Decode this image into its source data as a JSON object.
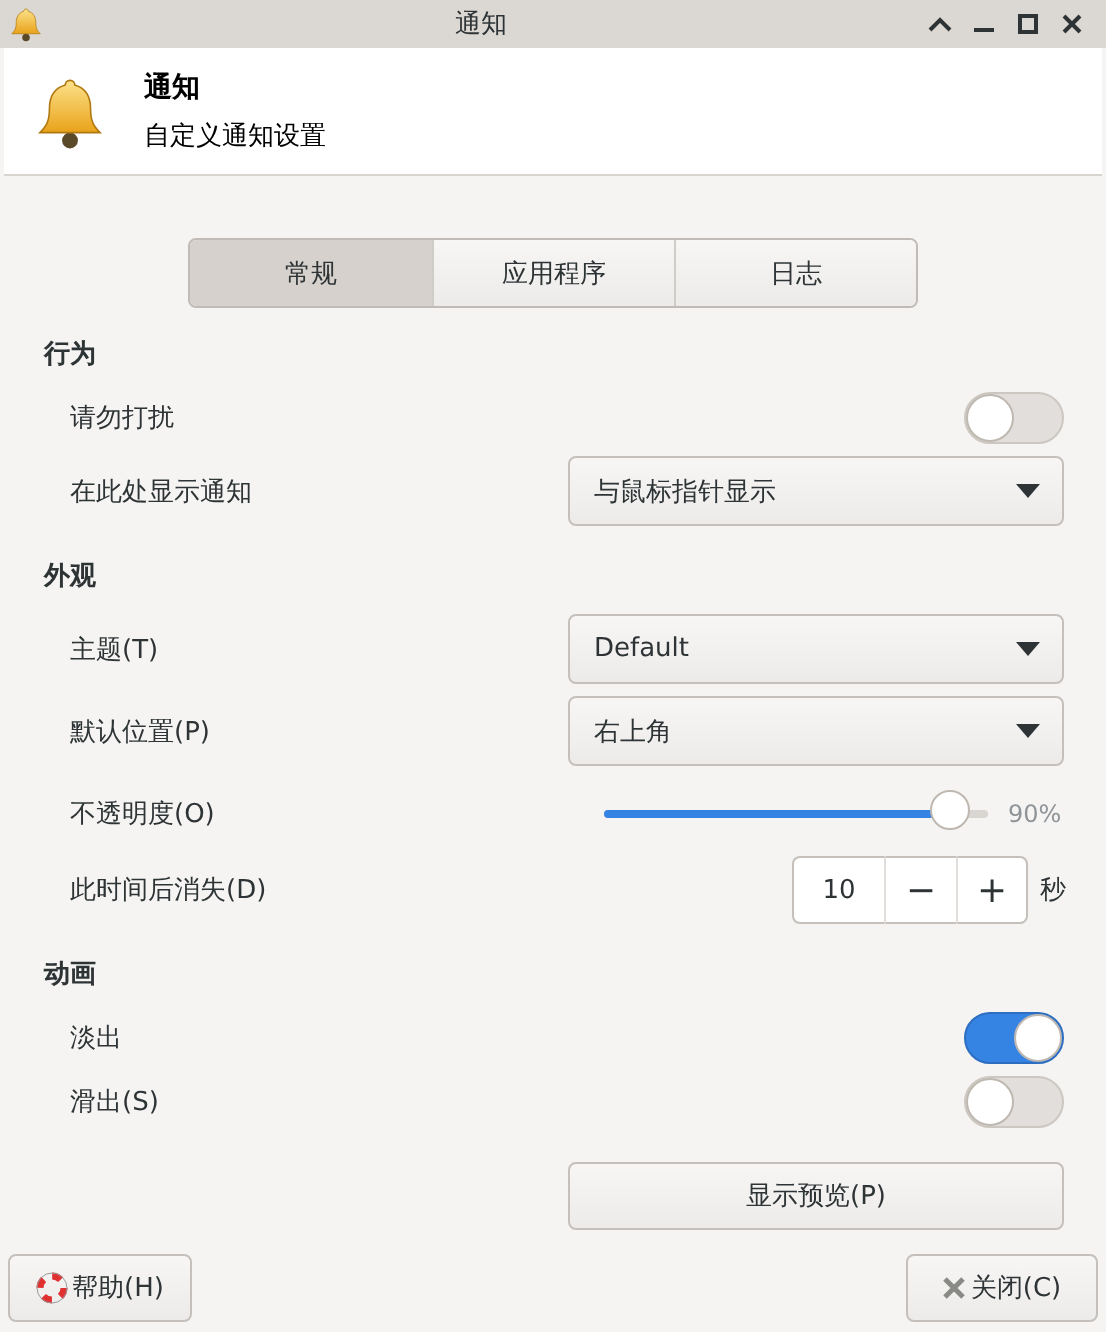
{
  "window": {
    "title": "通知"
  },
  "header": {
    "title": "通知",
    "subtitle": "自定义通知设置"
  },
  "tabs": [
    {
      "label": "常规",
      "selected": true
    },
    {
      "label": "应用程序",
      "selected": false
    },
    {
      "label": "日志",
      "selected": false
    }
  ],
  "sections": [
    {
      "title": "行为",
      "rows": [
        {
          "kind": "switch",
          "label": "请勿打扰",
          "on": false
        },
        {
          "kind": "combo",
          "label": "在此处显示通知",
          "value": "与鼠标指针显示"
        }
      ]
    },
    {
      "title": "外观",
      "rows": [
        {
          "kind": "combo",
          "label": "主题(T)",
          "value": "Default"
        },
        {
          "kind": "combo",
          "label": "默认位置(P)",
          "value": "右上角"
        },
        {
          "kind": "slider",
          "label": "不透明度(O)",
          "level": 0.9,
          "reading": "90%"
        },
        {
          "kind": "spin",
          "label": "此时间后消失(D)",
          "value": "10",
          "minus": "−",
          "plus": "+",
          "unit": "秒"
        }
      ]
    },
    {
      "title": "动画",
      "rows": [
        {
          "kind": "switch",
          "label": "淡出",
          "on": true
        },
        {
          "kind": "switch",
          "label": "滑出(S)",
          "on": false
        }
      ]
    }
  ],
  "preview_button": "显示预览(P)",
  "buttons": [
    {
      "kind": "help",
      "label": "帮助(H)"
    },
    {
      "kind": "close",
      "label": "关闭(C)"
    }
  ]
}
